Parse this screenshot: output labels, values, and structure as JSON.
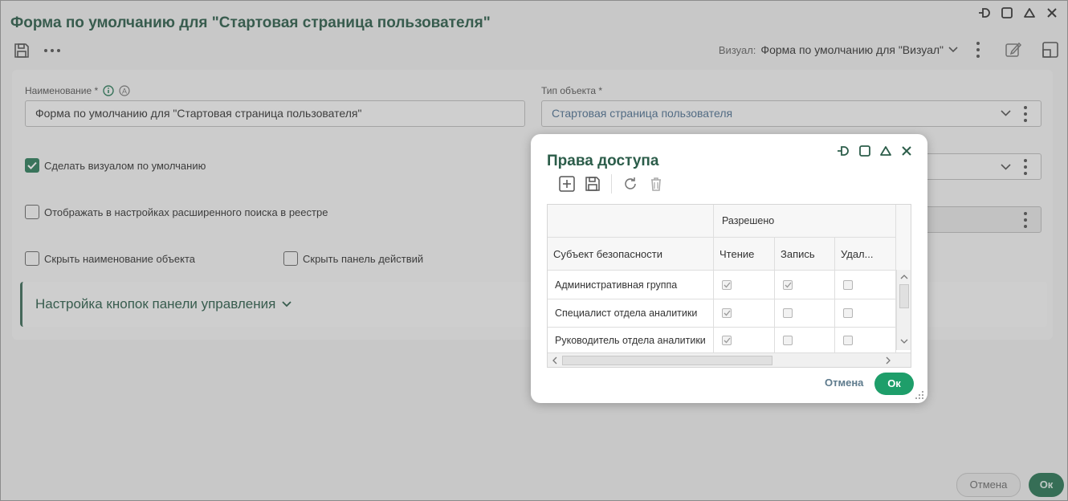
{
  "window": {
    "title": "Форма по умолчанию для \"Стартовая страница пользователя\""
  },
  "visual_selector": {
    "label": "Визуал:",
    "value": "Форма по умолчанию для \"Визуал\""
  },
  "form": {
    "name_label": "Наименование *",
    "name_value": "Форма по умолчанию для \"Стартовая страница пользователя\"",
    "object_type_label": "Тип объекта *",
    "object_type_value": "Стартовая страница пользователя",
    "checkboxes": [
      {
        "label": "Сделать визуалом по умолчанию",
        "checked": true
      },
      {
        "label": "Отображать в настройках расширенного поиска в реестре",
        "checked": false
      },
      {
        "label": "Скрыть наименование объекта",
        "checked": false
      },
      {
        "label": "Скрыть панель действий",
        "checked": false
      }
    ],
    "section_title": "Настройка кнопок панели управления"
  },
  "bottom": {
    "cancel": "Отмена",
    "ok": "Ок"
  },
  "dialog": {
    "title": "Права доступа",
    "group_header": "Разрешено",
    "columns": [
      "Субъект безопасности",
      "Чтение",
      "Запись",
      "Удал..."
    ],
    "rows": [
      {
        "subject": "Административная группа",
        "read": true,
        "write": true,
        "delete": false
      },
      {
        "subject": "Специалист отдела аналитики",
        "read": true,
        "write": false,
        "delete": false
      },
      {
        "subject": "Руководитель отдела аналитики",
        "read": true,
        "write": false,
        "delete": false
      }
    ],
    "cancel": "Отмена",
    "ok": "Ок"
  },
  "colors": {
    "accent": "#2c5d4a",
    "ok_button": "#1e9e6a",
    "checkbox_on": "#2e7d5b"
  }
}
